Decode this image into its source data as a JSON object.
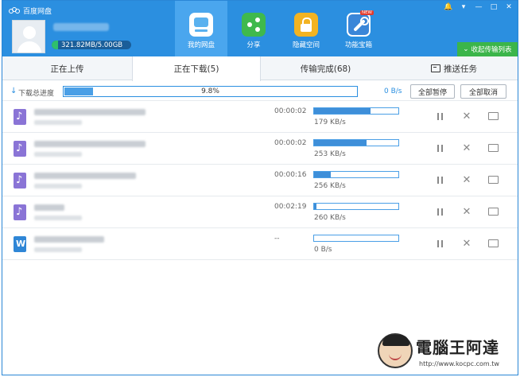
{
  "app": {
    "title": "百度网盘"
  },
  "user": {
    "quota_text": "321.82MB/5.00GB",
    "quota_used_fraction": 0.06
  },
  "nav": {
    "items": [
      {
        "label": "我的网盘",
        "icon": "cloud-disk-icon",
        "active": true
      },
      {
        "label": "分享",
        "icon": "share-icon",
        "active": false
      },
      {
        "label": "隐藏空间",
        "icon": "lock-icon",
        "active": false
      },
      {
        "label": "功能宝箱",
        "icon": "toolbox-icon",
        "active": false,
        "badge": "NEW"
      }
    ]
  },
  "window_controls": {
    "bell": "🔔",
    "menu": "▾",
    "minimize": "—",
    "maximize": "□",
    "close": "✕"
  },
  "collapse_label": "收起传输列表",
  "tabs": {
    "uploading": "正在上传",
    "downloading": "正在下载(5)",
    "completed": "传输完成(68)",
    "push": "推送任务"
  },
  "total": {
    "label": "下载总进度",
    "percent_text": "9.8%",
    "percent": 0.098,
    "speed": "0 B/s",
    "pause_all": "全部暂停",
    "cancel_all": "全部取消"
  },
  "downloads": [
    {
      "type": "music",
      "time": "00:00:02",
      "progress": 0.67,
      "speed": "179 KB/s"
    },
    {
      "type": "music",
      "time": "00:00:02",
      "progress": 0.62,
      "speed": "253 KB/s"
    },
    {
      "type": "music",
      "time": "00:00:16",
      "progress": 0.2,
      "speed": "256 KB/s"
    },
    {
      "type": "music",
      "time": "00:02:19",
      "progress": 0.03,
      "speed": "260 KB/s"
    },
    {
      "type": "word",
      "time": "--",
      "progress": 0.0,
      "speed": "0 B/s"
    }
  ],
  "watermark": {
    "text": "電腦王阿達",
    "url": "http://www.kocpc.com.tw"
  },
  "colors": {
    "header": "#2b8fe0",
    "accent_green": "#3bb54a",
    "progress": "#3e8fd9"
  }
}
